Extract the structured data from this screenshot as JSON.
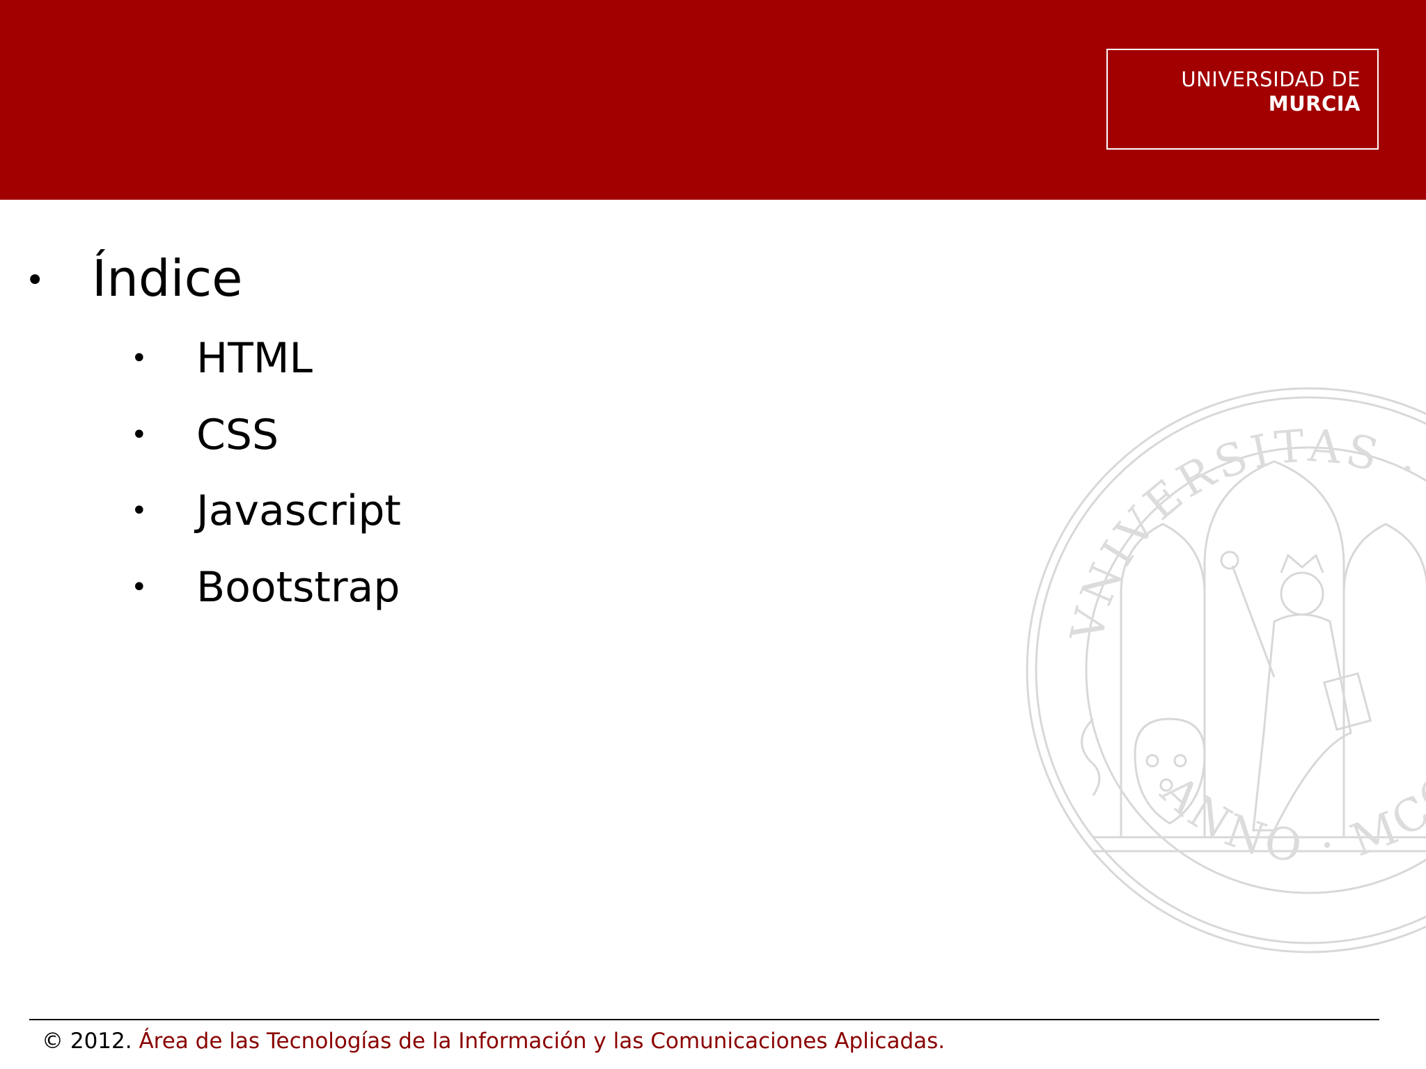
{
  "header": {
    "logo": {
      "line1": "UNIVERSIDAD DE",
      "line2": "MURCIA"
    },
    "band_color": "#a20000"
  },
  "content": {
    "title_bullet": "•",
    "title": "Índice",
    "items": [
      {
        "bullet": "•",
        "label": "HTML"
      },
      {
        "bullet": "•",
        "label": "CSS"
      },
      {
        "bullet": "•",
        "label": "Javascript"
      },
      {
        "bullet": "•",
        "label": "Bootstrap"
      }
    ]
  },
  "watermark": {
    "top_text": "VNIVERSITAS · STVDIORVM",
    "bottom_text": "ANNO · MCCLXX",
    "icon": "university-seal-icon"
  },
  "footer": {
    "copyright": "© 2012.",
    "organization": "Área de las Tecnologías de la Información y las Comunicaciones Aplicadas.",
    "organization_color": "#8a0000"
  }
}
